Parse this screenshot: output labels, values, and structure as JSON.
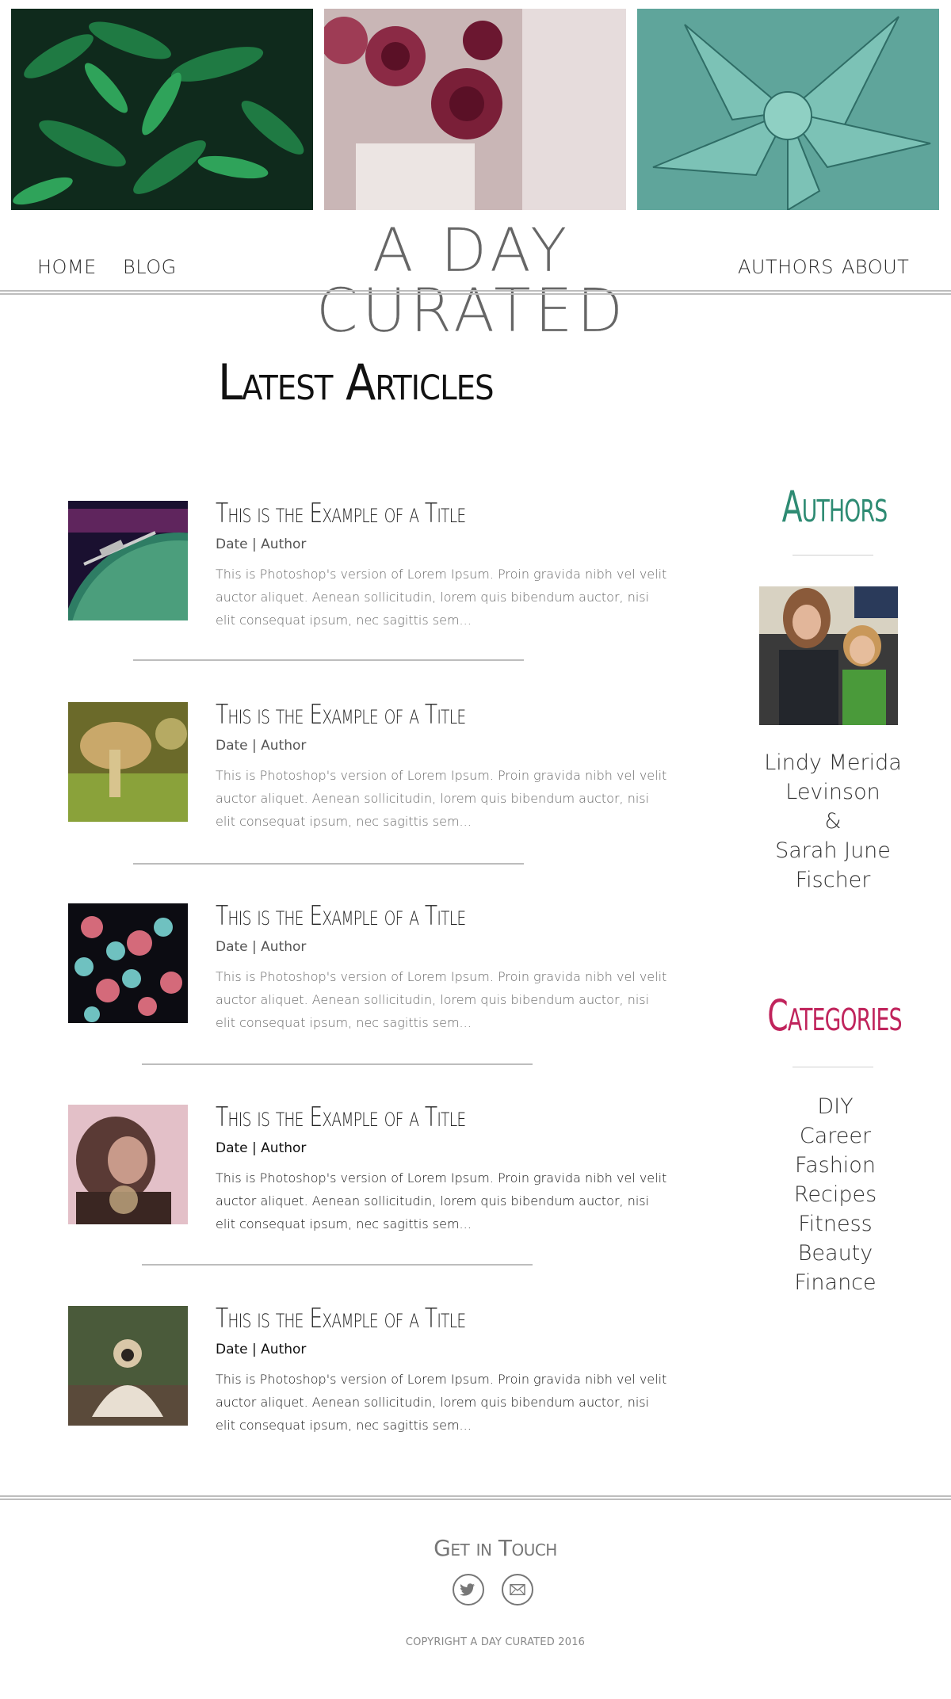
{
  "header": {
    "site_title": "A DAY CURATED",
    "nav": {
      "home": "HOME",
      "blog": "BLOG",
      "authors": "AUTHORS",
      "about": "ABOUT"
    }
  },
  "main": {
    "heading": "Latest Articles",
    "articles": [
      {
        "title": "This is the Example of a Title",
        "meta": "Date | Author",
        "excerpt": "This is Photoshop's version  of Lorem Ipsum. Proin gravida nibh vel velit auctor aliquet. Aenean sollicitudin, lorem quis bibendum auctor, nisi elit consequat ipsum, nec sagittis sem..."
      },
      {
        "title": "This is the Example of a Title",
        "meta": "Date | Author",
        "excerpt": "This is Photoshop's version  of Lorem Ipsum. Proin gravida nibh vel velit auctor aliquet. Aenean sollicitudin, lorem quis bibendum auctor, nisi elit consequat ipsum, nec sagittis sem..."
      },
      {
        "title": "This is the Example of a Title",
        "meta": "Date | Author",
        "excerpt": "This is Photoshop's version  of Lorem Ipsum. Proin gravida nibh vel velit auctor aliquet. Aenean sollicitudin, lorem quis bibendum auctor, nisi elit consequat ipsum, nec sagittis sem..."
      },
      {
        "title": "This is the Example of a Title",
        "meta": "Date | Author",
        "excerpt": "This is Photoshop's version  of Lorem Ipsum. Proin gravida nibh vel velit auctor aliquet. Aenean sollicitudin, lorem quis bibendum auctor, nisi elit consequat ipsum, nec sagittis sem..."
      },
      {
        "title": "This is the Example of a Title",
        "meta": "Date | Author",
        "excerpt": "This is Photoshop's version  of Lorem Ipsum. Proin gravida nibh vel velit auctor aliquet. Aenean sollicitudin, lorem quis bibendum auctor, nisi elit consequat ipsum, nec sagittis sem..."
      }
    ]
  },
  "sidebar": {
    "authors_heading": "Authors",
    "author_lines": [
      "Lindy Merida",
      "Levinson",
      "&",
      "Sarah June",
      "Fischer"
    ],
    "categories_heading": "Categories",
    "categories": [
      "DIY",
      "Career",
      "Fashion",
      "Recipes",
      "Fitness",
      "Beauty",
      "Finance"
    ]
  },
  "footer": {
    "heading": "Get in Touch",
    "copyright": "COPYRIGHT A DAY CURATED 2016"
  },
  "colors": {
    "authors_accent": "#2e8b73",
    "categories_accent": "#c0245c",
    "divider": "#bdbdbd"
  },
  "icons": [
    "twitter-icon",
    "email-icon"
  ]
}
